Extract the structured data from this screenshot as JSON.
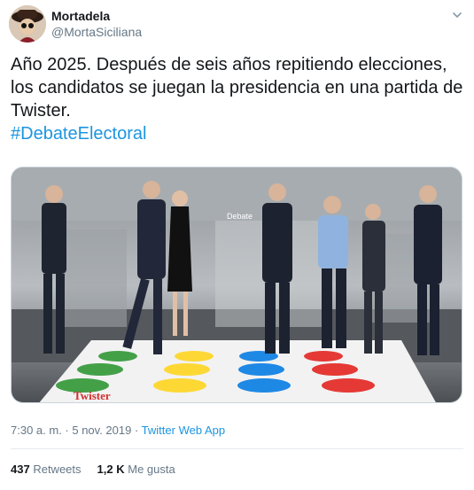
{
  "user": {
    "display_name": "Mortadela",
    "handle": "@MortaSiciliana"
  },
  "tweet": {
    "text": "Año 2025. Después de seis años repitiendo elecciones, los candidatos se juegan la presidencia en una partida de Twister.",
    "hashtag": "#DebateElectoral"
  },
  "media": {
    "mat_logo": "Twister",
    "backdrop_sign": "Debate"
  },
  "meta": {
    "timestamp": "7:30 a. m. · 5 nov. 2019",
    "separator": " · ",
    "source": "Twitter Web App"
  },
  "stats": {
    "retweets_count": "437",
    "retweets_label": "Retweets",
    "likes_count": "1,2 K",
    "likes_label": "Me gusta"
  },
  "colors": {
    "link": "#1b95e0",
    "secondary_text": "#657786",
    "twister_red": "#e53935",
    "twister_blue": "#1e88e5",
    "twister_yellow": "#fdd835",
    "twister_green": "#43a047"
  }
}
